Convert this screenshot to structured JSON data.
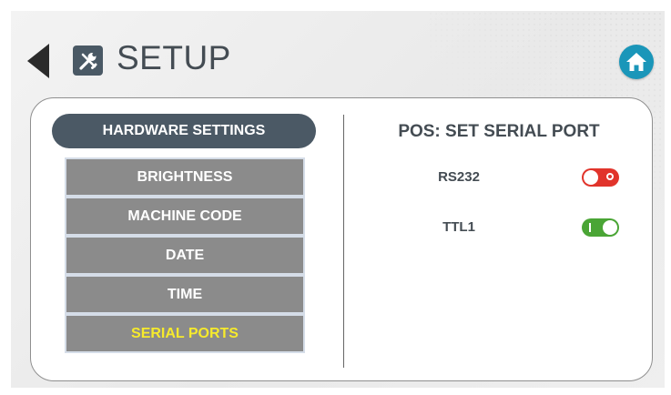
{
  "header": {
    "title": "SETUP",
    "back_icon": "back-arrow-icon",
    "title_icon": "tools-icon",
    "home_icon": "home-icon"
  },
  "sidebar": {
    "section_title": "HARDWARE SETTINGS",
    "items": [
      {
        "label": "BRIGHTNESS",
        "active": false
      },
      {
        "label": "MACHINE CODE",
        "active": false
      },
      {
        "label": "DATE",
        "active": false
      },
      {
        "label": "TIME",
        "active": false
      },
      {
        "label": "SERIAL PORTS",
        "active": true
      }
    ]
  },
  "content": {
    "title": "POS: SET SERIAL PORT",
    "ports": [
      {
        "label": "RS232",
        "enabled": false
      },
      {
        "label": "TTL1",
        "enabled": true
      }
    ]
  },
  "colors": {
    "header_dark": "#4b5965",
    "menu_item": "#8b8b8b",
    "active_text": "#f6ea2c",
    "home_button": "#1a96b9",
    "toggle_off": "#e1342b",
    "toggle_on": "#4aa535"
  }
}
